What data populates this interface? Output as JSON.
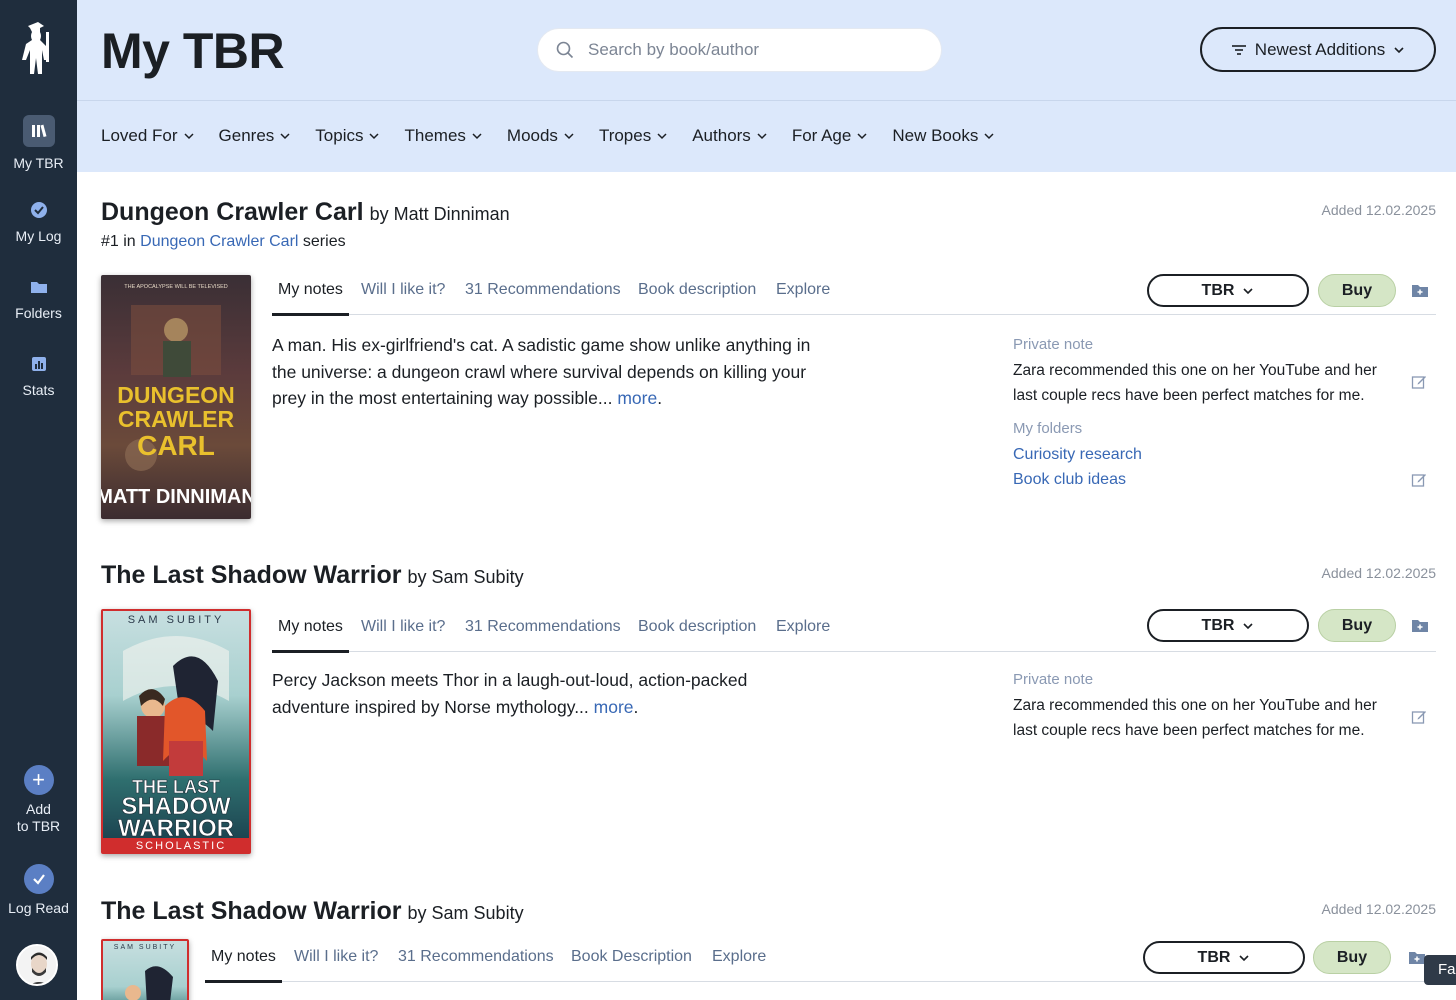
{
  "sidebar": {
    "items": [
      {
        "label": "My TBR",
        "icon": "books-icon",
        "active": true
      },
      {
        "label": "My Log",
        "icon": "check-badge-icon"
      },
      {
        "label": "Folders",
        "icon": "folder-icon"
      },
      {
        "label": "Stats",
        "icon": "bar-chart-icon"
      }
    ],
    "add_label_1": "Add",
    "add_label_2": "to TBR",
    "log_label": "Log Read"
  },
  "header": {
    "title": "My TBR",
    "search_placeholder": "Search by book/author",
    "sort_label": "Newest Additions",
    "nav": [
      "Loved For",
      "Genres",
      "Topics",
      "Themes",
      "Moods",
      "Tropes",
      "Authors",
      "For Age",
      "New Books"
    ]
  },
  "books": [
    {
      "title": "Dungeon Crawler Carl",
      "by": "by Matt Dinniman",
      "series_prefix": "#1 in",
      "series_name": "Dungeon Crawler Carl",
      "series_suffix": "series",
      "added": "Added 12.02.2025",
      "tabs": [
        "My notes",
        "Will I like it?",
        "31 Recommendations",
        "Book description",
        "Explore"
      ],
      "status": "TBR",
      "buy": "Buy",
      "description": "A man. His ex-girlfriend's cat. A sadistic game show unlike anything in the universe: a dungeon crawl where survival depends on killing your prey in the most entertaining way possible...",
      "more": "more",
      "private_note_label": "Private note",
      "private_note": "Zara recommended this one on her YouTube and her last couple recs have been perfect matches for me.",
      "folders_label": "My folders",
      "folders": [
        "Curiosity research",
        "Book club ideas"
      ],
      "cover": {
        "top_text": "THE APOCALYPSE WILL BE TELEVISED",
        "title_lines": [
          "DUNGEON",
          "CRAWLER",
          "CARL"
        ],
        "author": "MATT DINNIMAN"
      }
    },
    {
      "title": "The Last Shadow Warrior",
      "by": "by Sam Subity",
      "added": "Added 12.02.2025",
      "tabs": [
        "My notes",
        "Will I like it?",
        "31 Recommendations",
        "Book description",
        "Explore"
      ],
      "status": "TBR",
      "buy": "Buy",
      "description": "Percy Jackson meets Thor in a laugh-out-loud, action-packed adventure inspired by Norse mythology...",
      "more": "more",
      "private_note_label": "Private note",
      "private_note": "Zara recommended this one on her YouTube and her last couple recs have been perfect matches for me.",
      "cover": {
        "author": "SAM SUBITY",
        "title_lines": [
          "THE LAST",
          "SHADOW",
          "WARRIOR"
        ],
        "publisher": "SCHOLASTIC"
      }
    },
    {
      "title": "The Last Shadow Warrior",
      "by": "by Sam Subity",
      "added": "Added 12.02.2025",
      "tabs": [
        "My notes",
        "Will I like it?",
        "31 Recommendations",
        "Book Description",
        "Explore"
      ],
      "status": "TBR",
      "buy": "Buy",
      "cover": {
        "author": "SAM SUBITY"
      }
    }
  ],
  "overlay_tab": "Fa",
  "colors": {
    "sidebar": "#1f2d3d",
    "header": "#dce8fb",
    "link": "#3868b5",
    "buy": "#d5e6c6"
  }
}
